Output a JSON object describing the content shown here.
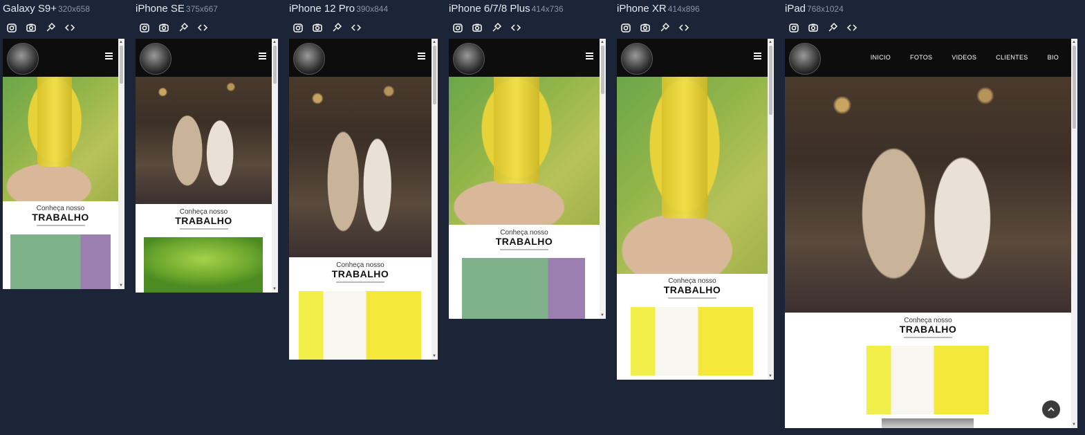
{
  "devices": [
    {
      "name": "Galaxy S9+",
      "size": "320x658"
    },
    {
      "name": "iPhone SE",
      "size": "375x667"
    },
    {
      "name": "iPhone 12 Pro",
      "size": "390x844"
    },
    {
      "name": "iPhone 6/7/8 Plus",
      "size": "414x736"
    },
    {
      "name": "iPhone XR",
      "size": "414x896"
    },
    {
      "name": "iPad",
      "size": "768x1024"
    }
  ],
  "toolbar_icons": [
    "instagram-icon",
    "camera-icon",
    "link-icon",
    "code-icon"
  ],
  "site": {
    "nav": [
      "INICIO",
      "FOTOS",
      "VIDEOS",
      "CLIENTES",
      "BIO"
    ],
    "work_sub": "Conheça nosso",
    "work_title": "TRABALHO"
  },
  "colors": {
    "page_bg": "#1c2538",
    "nav_bg": "#0d0d0d"
  }
}
